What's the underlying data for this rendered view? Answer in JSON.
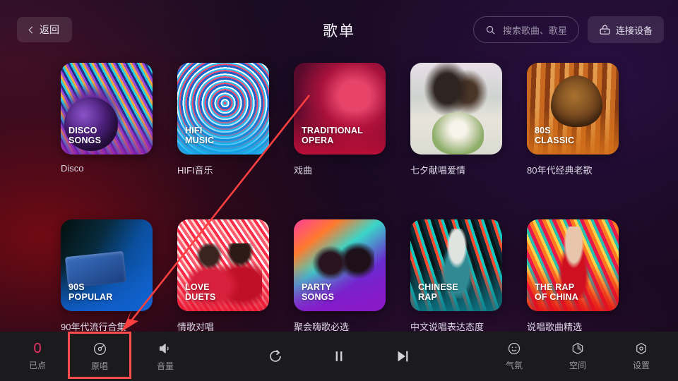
{
  "header": {
    "back_label": "返回",
    "back_icon": "chevron-left-icon",
    "title": "歌单",
    "search_placeholder": "搜索歌曲、歌星",
    "search_icon": "search-icon",
    "connect_label": "连接设备",
    "connect_icon": "cast-device-icon"
  },
  "grid": {
    "rows": [
      [
        {
          "art": "art-disco",
          "cover_title": "DISCO\nSONGS",
          "label": "Disco"
        },
        {
          "art": "art-hifi",
          "cover_title": "HIFI\nMUSIC",
          "label": "HIFI音乐"
        },
        {
          "art": "art-opera",
          "cover_title": "TRADITIONAL\nOPERA",
          "label": "戏曲"
        },
        {
          "art": "art-couple",
          "cover_title": "",
          "label": "七夕献唱爱情"
        },
        {
          "art": "art-80s",
          "cover_title": "80S\nCLASSIC",
          "label": "80年代经典老歌"
        }
      ],
      [
        {
          "art": "art-90s",
          "cover_title": "90S\nPOPULAR",
          "label": "90年代流行合集"
        },
        {
          "art": "art-love",
          "cover_title": "LOVE\nDUETS",
          "label": "情歌对唱"
        },
        {
          "art": "art-party",
          "cover_title": "PARTY\nSONGS",
          "label": "聚会嗨歌必选"
        },
        {
          "art": "art-crap",
          "cover_title": "CHINESE\nRAP",
          "label": "中文说唱表达态度"
        },
        {
          "art": "art-trap",
          "cover_title": "THE RAP\nOF CHINA",
          "label": "说唱歌曲精选"
        }
      ]
    ]
  },
  "bottombar": {
    "queued_count": "0",
    "queued_label": "已点",
    "original_vocal_label": "原唱",
    "original_vocal_icon": "disc-icon",
    "volume_label": "音量",
    "volume_icon": "speaker-icon",
    "replay_icon": "replay-icon",
    "pause_icon": "pause-icon",
    "next_icon": "next-track-icon",
    "mood_label": "气氛",
    "mood_icon": "smiley-icon",
    "space_label": "空间",
    "space_icon": "cube-icon",
    "settings_label": "设置",
    "settings_icon": "gear-icon"
  },
  "annotation": {
    "color": "#ff4040",
    "highlight_color": "#ff4d4d",
    "target": "原唱"
  }
}
